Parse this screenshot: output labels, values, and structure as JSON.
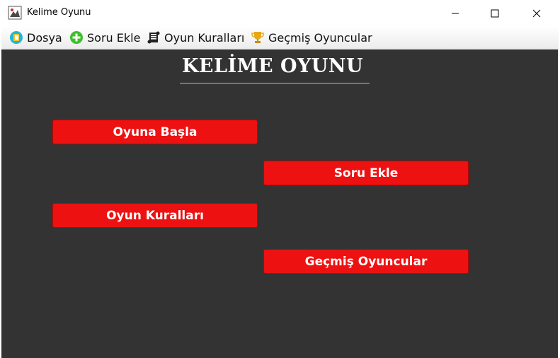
{
  "window": {
    "title": "Kelime Oyunu"
  },
  "menu": {
    "items": [
      {
        "label": "Dosya",
        "icon": "dosya-icon"
      },
      {
        "label": "Soru Ekle",
        "icon": "add-icon"
      },
      {
        "label": "Oyun Kuralları",
        "icon": "scroll-icon"
      },
      {
        "label": "Geçmiş Oyuncular",
        "icon": "trophy-icon"
      }
    ]
  },
  "main": {
    "heading": "KELİME OYUNU",
    "buttons": [
      {
        "label": "Oyuna Başla"
      },
      {
        "label": "Soru Ekle"
      },
      {
        "label": "Oyun Kuralları"
      },
      {
        "label": "Geçmiş Oyuncular"
      }
    ]
  },
  "colors": {
    "background": "#333333",
    "button": "#ee1111",
    "button_text": "#ffffff",
    "heading": "#ffffff"
  }
}
